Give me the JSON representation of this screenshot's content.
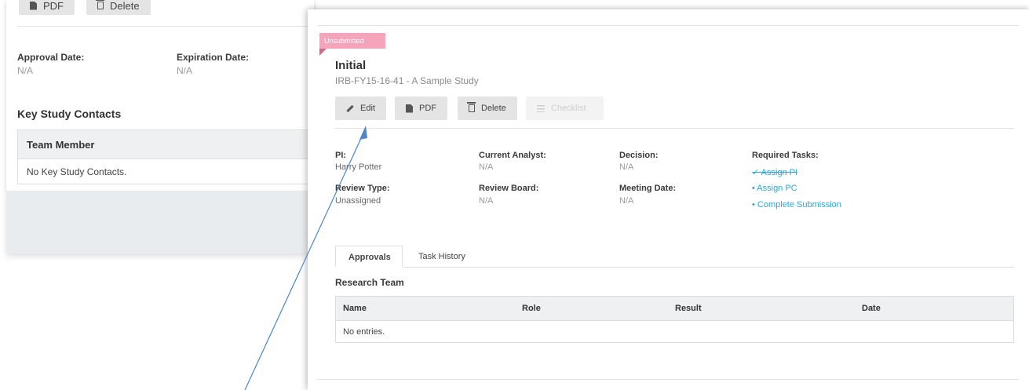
{
  "background_panel": {
    "buttons": {
      "pdf": "PDF",
      "delete": "Delete"
    },
    "approval_date_label": "Approval Date:",
    "approval_date_value": "N/A",
    "expiration_date_label": "Expiration Date:",
    "expiration_date_value": "N/A",
    "contacts_heading": "Key Study Contacts",
    "contacts_table": {
      "column": "Team Member",
      "empty": "No Key Study Contacts."
    }
  },
  "front_panel": {
    "status_badge": "Unsubmitted",
    "title": "Initial",
    "subtitle": "IRB-FY15-16-41 - A Sample Study",
    "buttons": {
      "edit": "Edit",
      "pdf": "PDF",
      "delete": "Delete",
      "checklist": "Checklist"
    },
    "fields": {
      "pi_label": "PI:",
      "pi_value": "Harry Potter",
      "analyst_label": "Current Analyst:",
      "analyst_value": "N/A",
      "decision_label": "Decision:",
      "decision_value": "N/A",
      "review_type_label": "Review Type:",
      "review_type_value": "Unassigned",
      "review_board_label": "Review Board:",
      "review_board_value": "N/A",
      "meeting_date_label": "Meeting Date:",
      "meeting_date_value": "N/A"
    },
    "required_tasks": {
      "label": "Required Tasks:",
      "items": [
        {
          "text": "✓ Assign PI",
          "done": true
        },
        {
          "text": "• Assign PC",
          "done": false
        },
        {
          "text": "• Complete Submission",
          "done": false
        }
      ]
    },
    "tabs": [
      "Approvals",
      "Task History"
    ],
    "research_team_heading": "Research Team",
    "table": {
      "columns": [
        "Name",
        "Role",
        "Result",
        "Date"
      ],
      "empty": "No entries."
    }
  },
  "colors": {
    "badge": "#f6a4bb",
    "link": "#2aa7d6",
    "arrow": "#4a86c8"
  },
  "icons": [
    "file-icon",
    "trash-icon",
    "pencil-icon",
    "list-icon"
  ]
}
